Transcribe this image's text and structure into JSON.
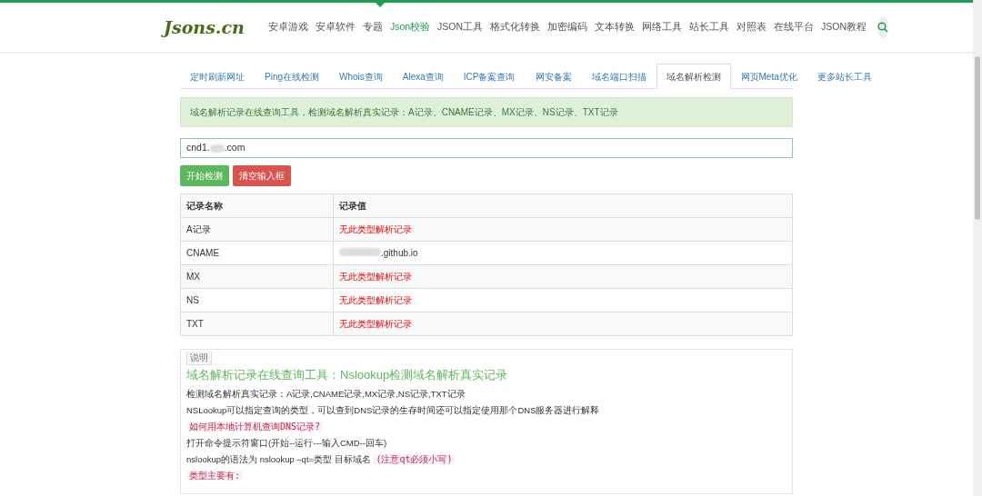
{
  "logo": "Jsons.cn",
  "nav": [
    {
      "label": "安卓游戏",
      "selected": false
    },
    {
      "label": "安卓软件",
      "selected": false
    },
    {
      "label": "专题",
      "selected": false
    },
    {
      "label": "Json校验",
      "selected": true
    },
    {
      "label": "JSON工具",
      "selected": false
    },
    {
      "label": "格式化转换",
      "selected": false
    },
    {
      "label": "加密编码",
      "selected": false
    },
    {
      "label": "文本转换",
      "selected": false
    },
    {
      "label": "网络工具",
      "selected": false
    },
    {
      "label": "站长工具",
      "selected": false
    },
    {
      "label": "对照表",
      "selected": false
    },
    {
      "label": "在线平台",
      "selected": false
    },
    {
      "label": "JSON教程",
      "selected": false
    }
  ],
  "tabs": [
    {
      "label": "定时刷新网址",
      "selected": false
    },
    {
      "label": "Ping在线检测",
      "selected": false
    },
    {
      "label": "Whois查询",
      "selected": false
    },
    {
      "label": "Alexa查询",
      "selected": false
    },
    {
      "label": "ICP备案查询",
      "selected": false
    },
    {
      "label": "网安备案",
      "selected": false
    },
    {
      "label": "域名端口扫描",
      "selected": false
    },
    {
      "label": "域名解析检测",
      "selected": true
    },
    {
      "label": "网页Meta优化",
      "selected": false
    },
    {
      "label": "更多站长工具",
      "selected": false
    }
  ],
  "alert": "域名解析记录在线查询工具，检测域名解析真实记录：A记录、CNAME记录、MX记录、NS记录、TXT记录",
  "domain_field": {
    "value_start": "cnd1.",
    "value_end": ".com"
  },
  "buttons": [
    {
      "label": "开始检测",
      "kind": "primary"
    },
    {
      "label": "清空输入框",
      "kind": "danger"
    }
  ],
  "table": {
    "columns": [
      "记录名称",
      "记录值"
    ],
    "rows": [
      {
        "name": "A记录",
        "value": "无此类型解析记录",
        "found": false
      },
      {
        "name": "CNAME",
        "value": ".github.io",
        "found": true
      },
      {
        "name": "MX",
        "value": "无此类型解析记录",
        "found": false
      },
      {
        "name": "NS",
        "value": "无此类型解析记录",
        "found": false
      },
      {
        "name": "TXT",
        "value": "无此类型解析记录",
        "found": false
      }
    ]
  },
  "description": {
    "tag": "说明",
    "title": "域名解析记录在线查询工具：Nslookup检测域名解析真实记录",
    "lines": [
      {
        "kind": "text",
        "text": "检测域名解析真实记录：A记录,CNAME记录,MX记录,NS记录,TXT记录"
      },
      {
        "kind": "text",
        "text": "NSLookup可以指定查询的类型，可以查到DNS记录的生存时间还可以指定使用那个DNS服务器进行解释"
      },
      {
        "kind": "code",
        "text": "如何用本地计算机查询DNS记录?"
      },
      {
        "kind": "text",
        "text": "打开命令提示符窗口(开始--运行---输入CMD--回车)"
      },
      {
        "kind": "mixed",
        "text": "nslookup的语法为 nslookup –qt=类型 目标域名",
        "code": "(注意qt必须小写)"
      },
      {
        "kind": "code",
        "text": "类型主要有:"
      }
    ]
  }
}
